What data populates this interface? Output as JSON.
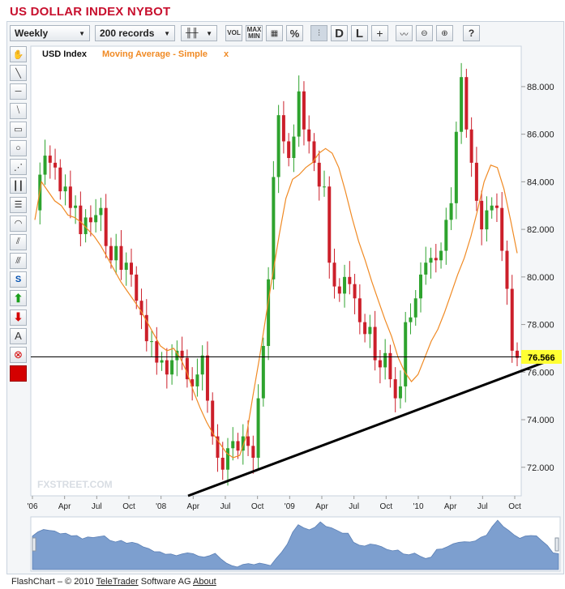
{
  "page_title": "US DOLLAR INDEX NYBOT",
  "toolbar": {
    "period": "Weekly",
    "records": "200 records",
    "vol_label": "VOL",
    "maxmin_label": "MAX MIN",
    "pct_label": "%",
    "d_label": "D",
    "l_label": "L",
    "help_label": "?"
  },
  "footer": {
    "prefix": "FlashChart – © 2010",
    "company": "TeleTrader",
    "middle": "Software AG",
    "about": "About"
  },
  "colors": {
    "title": "#c8102e",
    "up_candle": "#2ea32e",
    "down_candle": "#cc1f2a",
    "moving_average": "#f08a24",
    "trendline": "#000000",
    "last_price_bg": "#ffff33",
    "overview_fill": "#7d9fcf"
  },
  "chart_data": {
    "type": "candlestick",
    "title": "USD Index",
    "legend": [
      "USD Index",
      "Moving Average - Simple"
    ],
    "watermark": "FXSTREET.COM",
    "x_ticks": [
      "'06",
      "Apr",
      "Jul",
      "Oct",
      "'08",
      "Apr",
      "Jul",
      "Oct",
      "'09",
      "Apr",
      "Jul",
      "Oct",
      "'10",
      "Apr",
      "Jul",
      "Oct"
    ],
    "y_ticks": [
      "88.000",
      "86.000",
      "84.000",
      "82.000",
      "80.000",
      "78.000",
      "76.000",
      "74.000",
      "72.000"
    ],
    "ylim": [
      70.8,
      89.7
    ],
    "last_price": "76.566",
    "close_series": [
      82.8,
      84.3,
      85.1,
      84.8,
      84.6,
      83.6,
      83.8,
      82.9,
      83.0,
      81.8,
      82.5,
      82.3,
      82.6,
      82.9,
      81.3,
      80.7,
      81.3,
      80.3,
      80.6,
      80.1,
      79.0,
      78.4,
      77.3,
      77.3,
      76.4,
      76.5,
      75.9,
      76.5,
      76.9,
      76.6,
      75.7,
      75.4,
      75.9,
      76.7,
      74.8,
      73.3,
      72.4,
      71.9,
      72.8,
      73.1,
      72.7,
      73.3,
      72.9,
      72.4,
      74.9,
      77.1,
      79.9,
      84.2,
      86.8,
      85.7,
      85.0,
      85.9,
      87.8,
      86.2,
      85.7,
      84.8,
      83.8,
      83.8,
      80.6,
      79.6,
      79.3,
      80.0,
      79.7,
      79.1,
      78.1,
      77.6,
      77.9,
      76.5,
      76.2,
      76.8,
      75.7,
      74.9,
      75.4,
      78.1,
      78.3,
      79.1,
      80.1,
      80.6,
      80.8,
      80.7,
      81.1,
      82.4,
      83.1,
      86.1,
      88.4,
      86.2,
      84.8,
      83.2,
      82.0,
      82.8,
      83.0,
      82.9,
      81.1,
      79.5,
      76.9,
      76.6
    ],
    "ma_series": [
      82.4,
      84.0,
      83.6,
      83.2,
      83.0,
      82.6,
      82.5,
      82.3,
      82.0,
      81.7,
      81.3,
      80.8,
      80.3,
      79.8,
      79.4,
      79.0,
      78.6,
      78.1,
      77.6,
      77.1,
      76.9,
      77.0,
      76.6,
      76.0,
      75.2,
      74.5,
      73.9,
      73.4,
      73.0,
      72.6,
      72.4,
      72.5,
      73.3,
      75.0,
      76.6,
      78.4,
      80.1,
      81.8,
      83.3,
      84.1,
      84.3,
      84.6,
      84.8,
      85.2,
      85.4,
      85.2,
      84.6,
      83.6,
      82.5,
      81.5,
      80.7,
      79.8,
      79.0,
      78.2,
      77.5,
      76.6,
      76.0,
      75.6,
      75.9,
      76.6,
      77.3,
      77.8,
      78.5,
      79.3,
      80.1,
      80.8,
      81.7,
      82.8,
      84.0,
      84.7,
      84.6,
      83.7,
      82.4,
      81.0
    ]
  }
}
